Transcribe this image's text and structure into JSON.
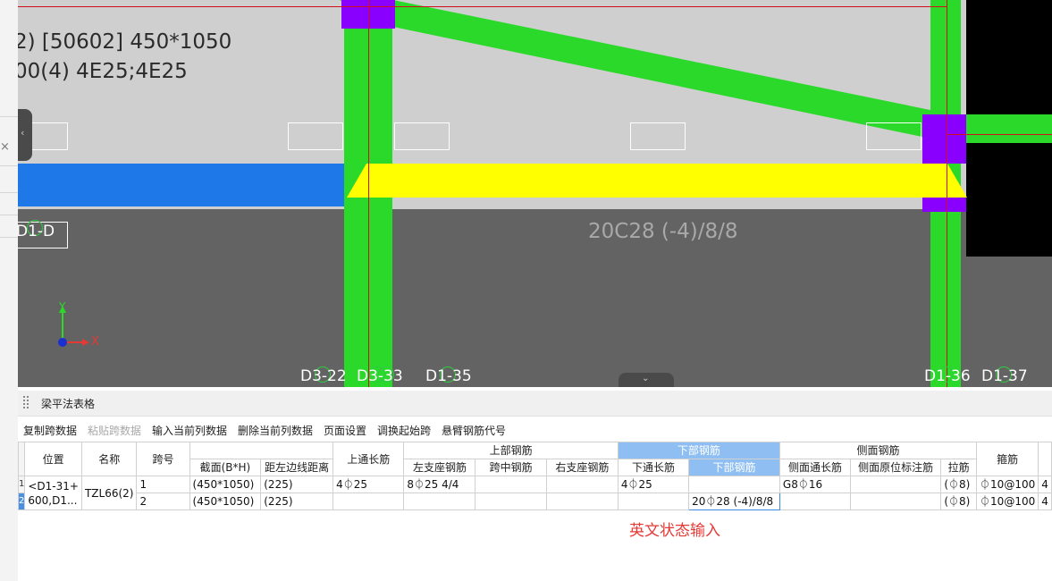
{
  "canvas": {
    "beam_label_line1": "2) [50602] 450*1050",
    "beam_label_line2": "00(4) 4E25;4E25",
    "bottom_rebar_label": "20C28 (-4)/8/8",
    "axis_tag": "D1-D",
    "axis_x_label": "X",
    "axis_y_label": "Y",
    "gridlines": [
      "D3-22",
      "D3-33",
      "D1-35",
      "D1-36",
      "D1-37"
    ],
    "gridline_overlap_label": "D3-33"
  },
  "panel": {
    "title": "梁平法表格",
    "toolbar": [
      "复制跨数据",
      "粘贴跨数据",
      "输入当前列数据",
      "删除当前列数据",
      "页面设置",
      "调换起始跨",
      "悬臂钢筋代号"
    ],
    "toolbar_disabled": [
      1
    ],
    "headers": {
      "position": "位置",
      "name": "名称",
      "span_no": "跨号",
      "section": "截面(B*H)",
      "edge_distance": "距左边线距离",
      "top_through": "上通长筋",
      "top_group": "上部钢筋",
      "left_support": "左支座钢筋",
      "mid_span": "跨中钢筋",
      "right_support": "右支座钢筋",
      "bottom_group": "下部钢筋",
      "bottom_through": "下通长筋",
      "bottom_rebar": "下部钢筋",
      "side_group": "侧面钢筋",
      "side_through": "侧面通长筋",
      "side_in_situ": "侧面原位标注筋",
      "tie": "拉筋",
      "stirrup": "箍筋"
    },
    "rows": [
      {
        "index": "1",
        "span": "1",
        "section": "(450*1050)",
        "edge_distance": "(225)",
        "top_through": "4⏀25",
        "left_support": "8⏀25 4/4",
        "mid_span": "",
        "right_support": "",
        "bottom_through": "4⏀25",
        "bottom_rebar": "",
        "side_through": "G8⏀16",
        "side_in_situ": "",
        "tie": "(⏀8)",
        "stirrup": "⏀10@100",
        "extra": "4"
      },
      {
        "index": "2",
        "span": "2",
        "section": "(450*1050)",
        "edge_distance": "(225)",
        "top_through": "",
        "left_support": "",
        "mid_span": "",
        "right_support": "",
        "bottom_through": "",
        "bottom_rebar": "20⏀28 (-4)/8/8",
        "side_through": "",
        "side_in_situ": "",
        "tie": "(⏀8)",
        "stirrup": "⏀10@100",
        "extra": "4"
      }
    ],
    "position_value": "<D1-31+\n600,D1...",
    "name_value": "TZL66(2)",
    "hint": "英文状态输入"
  },
  "colors": {
    "canvas_bg": "#cfcfcf",
    "canvas_lower": "#636363",
    "column_green": "#2bd92b",
    "selected_beam": "#ffff00",
    "blue_beam": "#1e78e8",
    "purple_node": "#8a00ff",
    "header_selected": "#8fbff2",
    "hint_red": "#e53935"
  }
}
